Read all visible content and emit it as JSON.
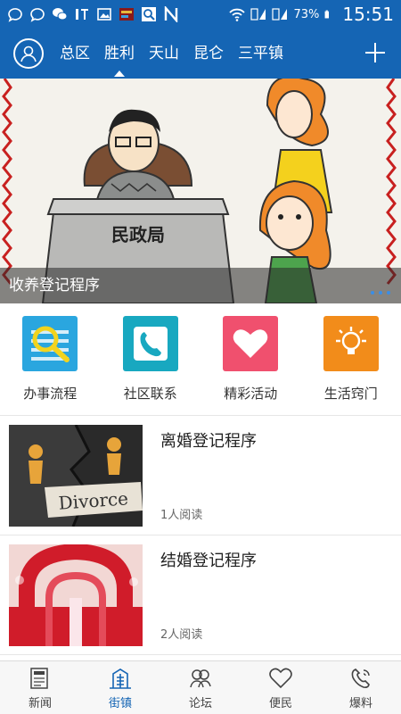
{
  "status_bar": {
    "battery": "73%",
    "time": "15:51"
  },
  "top_nav": {
    "tabs": [
      {
        "label": "总区"
      },
      {
        "label": "胜利"
      },
      {
        "label": "天山"
      },
      {
        "label": "昆仑"
      },
      {
        "label": "三平镇"
      }
    ],
    "active_tab": "胜利"
  },
  "banner": {
    "sign_text": "民政局",
    "caption": "收养登记程序"
  },
  "quick_actions": [
    {
      "label": "办事流程",
      "icon": "search-icon",
      "color": "#2aa6df"
    },
    {
      "label": "社区联系",
      "icon": "phone-icon",
      "color": "#18a8c0"
    },
    {
      "label": "精彩活动",
      "icon": "heart-icon",
      "color": "#f0506e"
    },
    {
      "label": "生活窍门",
      "icon": "lightbulb-icon",
      "color": "#f28c1a"
    }
  ],
  "articles": [
    {
      "title": "离婚登记程序",
      "reads": "1人阅读",
      "thumb_text": "Divorce"
    },
    {
      "title": "结婚登记程序",
      "reads": "2人阅读"
    }
  ],
  "bottom_nav": [
    {
      "label": "新闻",
      "icon": "news-icon"
    },
    {
      "label": "街镇",
      "icon": "building-icon"
    },
    {
      "label": "论坛",
      "icon": "forum-icon"
    },
    {
      "label": "便民",
      "icon": "heart-outline-icon"
    },
    {
      "label": "爆料",
      "icon": "phone-outline-icon"
    }
  ],
  "colors": {
    "primary": "#1565b4"
  }
}
